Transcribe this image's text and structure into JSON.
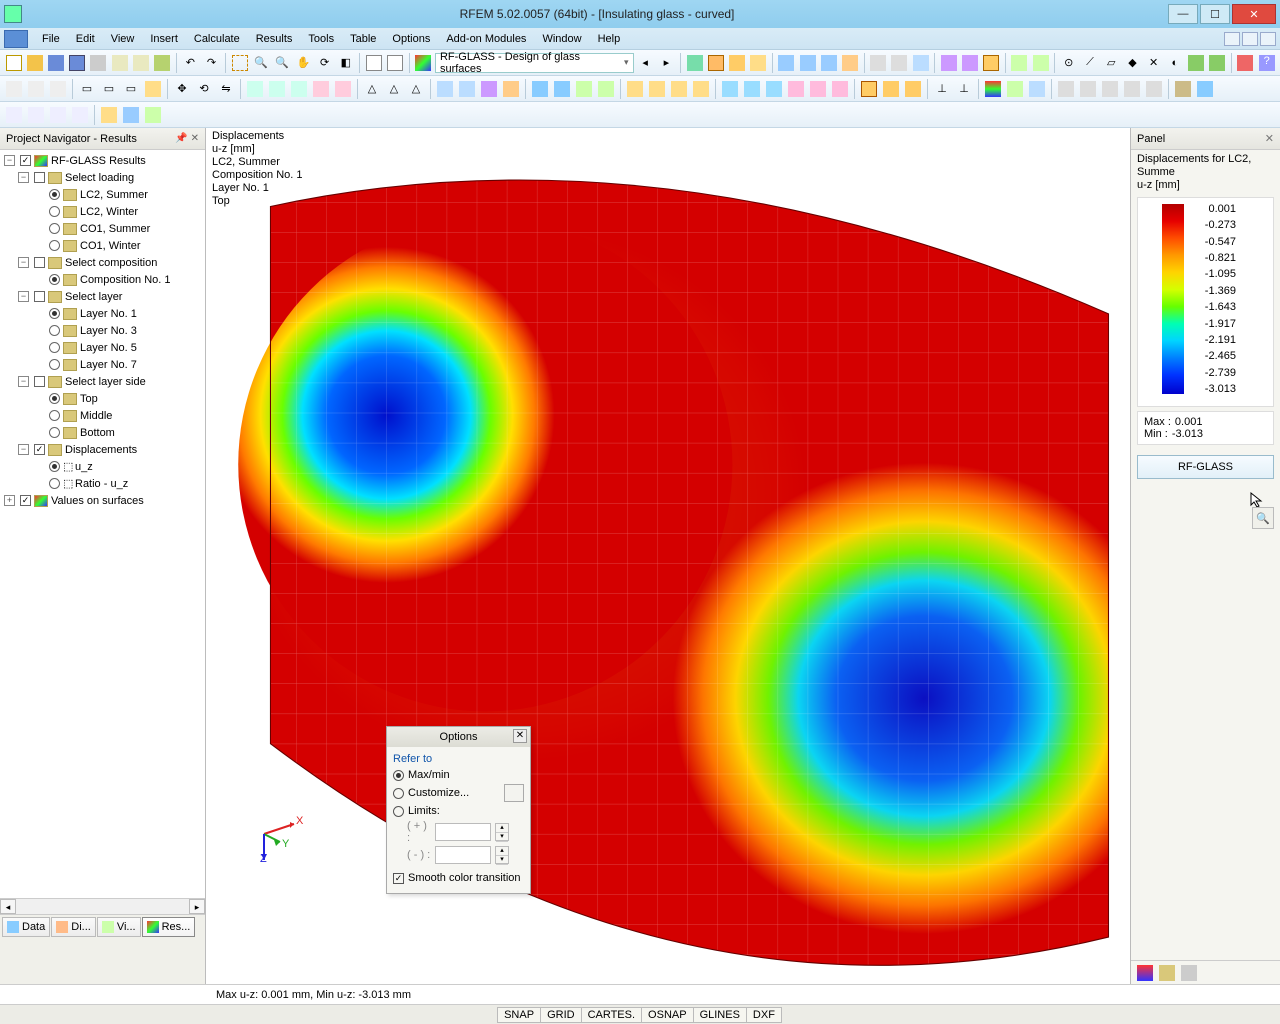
{
  "window": {
    "title": "RFEM 5.02.0057 (64bit) - [Insulating glass - curved]"
  },
  "menu": [
    "File",
    "Edit",
    "View",
    "Insert",
    "Calculate",
    "Results",
    "Tools",
    "Table",
    "Options",
    "Add-on Modules",
    "Window",
    "Help"
  ],
  "toolbar_combo": "RF-GLASS - Design of glass surfaces",
  "navigator": {
    "title": "Project Navigator - Results",
    "root": "RF-GLASS Results",
    "sections": {
      "loading": {
        "label": "Select loading",
        "items": [
          "LC2, Summer",
          "LC2, Winter",
          "CO1, Summer",
          "CO1, Winter"
        ],
        "selected": 0
      },
      "composition": {
        "label": "Select composition",
        "items": [
          "Composition No. 1"
        ],
        "selected": 0
      },
      "layer": {
        "label": "Select layer",
        "items": [
          "Layer No. 1",
          "Layer No. 3",
          "Layer No. 5",
          "Layer No. 7"
        ],
        "selected": 0
      },
      "side": {
        "label": "Select layer side",
        "items": [
          "Top",
          "Middle",
          "Bottom"
        ],
        "selected": 0
      },
      "displacements": {
        "label": "Displacements",
        "items": [
          "u_z",
          "Ratio - u_z"
        ],
        "selected": 0
      },
      "values": {
        "label": "Values on surfaces"
      }
    },
    "tabs": [
      "Data",
      "Di...",
      "Vi...",
      "Res..."
    ]
  },
  "viewport": {
    "lines": [
      "Displacements",
      "u-z [mm]",
      "LC2, Summer",
      "Composition No. 1",
      "Layer No. 1",
      "Top"
    ],
    "summary": "Max u-z: 0.001 mm, Min u-z: -3.013 mm"
  },
  "options": {
    "title": "Options",
    "group": "Refer to",
    "radios": [
      "Max/min",
      "Customize...",
      "Limits:"
    ],
    "selected": 0,
    "spin_labels": [
      "( + ) :",
      "( - ) :"
    ],
    "smooth": "Smooth color transition"
  },
  "panel": {
    "title": "Panel",
    "desc1": "Displacements for LC2, Summe",
    "desc2": "u-z [mm]",
    "ticks": [
      "0.001",
      "-0.273",
      "-0.547",
      "-0.821",
      "-1.095",
      "-1.369",
      "-1.643",
      "-1.917",
      "-2.191",
      "-2.465",
      "-2.739",
      "-3.013"
    ],
    "max_label": "Max  : ",
    "max_val": "0.001",
    "min_label": "Min   : ",
    "min_val": "-3.013",
    "button": "RF-GLASS"
  },
  "status": {
    "toggles": [
      "SNAP",
      "GRID",
      "CARTES.",
      "OSNAP",
      "GLINES",
      "DXF"
    ]
  },
  "chart_data": {
    "type": "heatmap",
    "title": "Displacements u-z [mm], LC2 Summer, Composition No.1, Layer No.1, Top",
    "unit": "mm",
    "value_range": [
      -3.013,
      0.001
    ],
    "colorbar_ticks": [
      0.001,
      -0.273,
      -0.547,
      -0.821,
      -1.095,
      -1.369,
      -1.643,
      -1.917,
      -2.191,
      -2.465,
      -2.739,
      -3.013
    ],
    "notes": "Curved insulating-glass surface FE result; two near-circular minima (~ -3.0 mm) roughly at quarter points along the span, edges near 0."
  }
}
